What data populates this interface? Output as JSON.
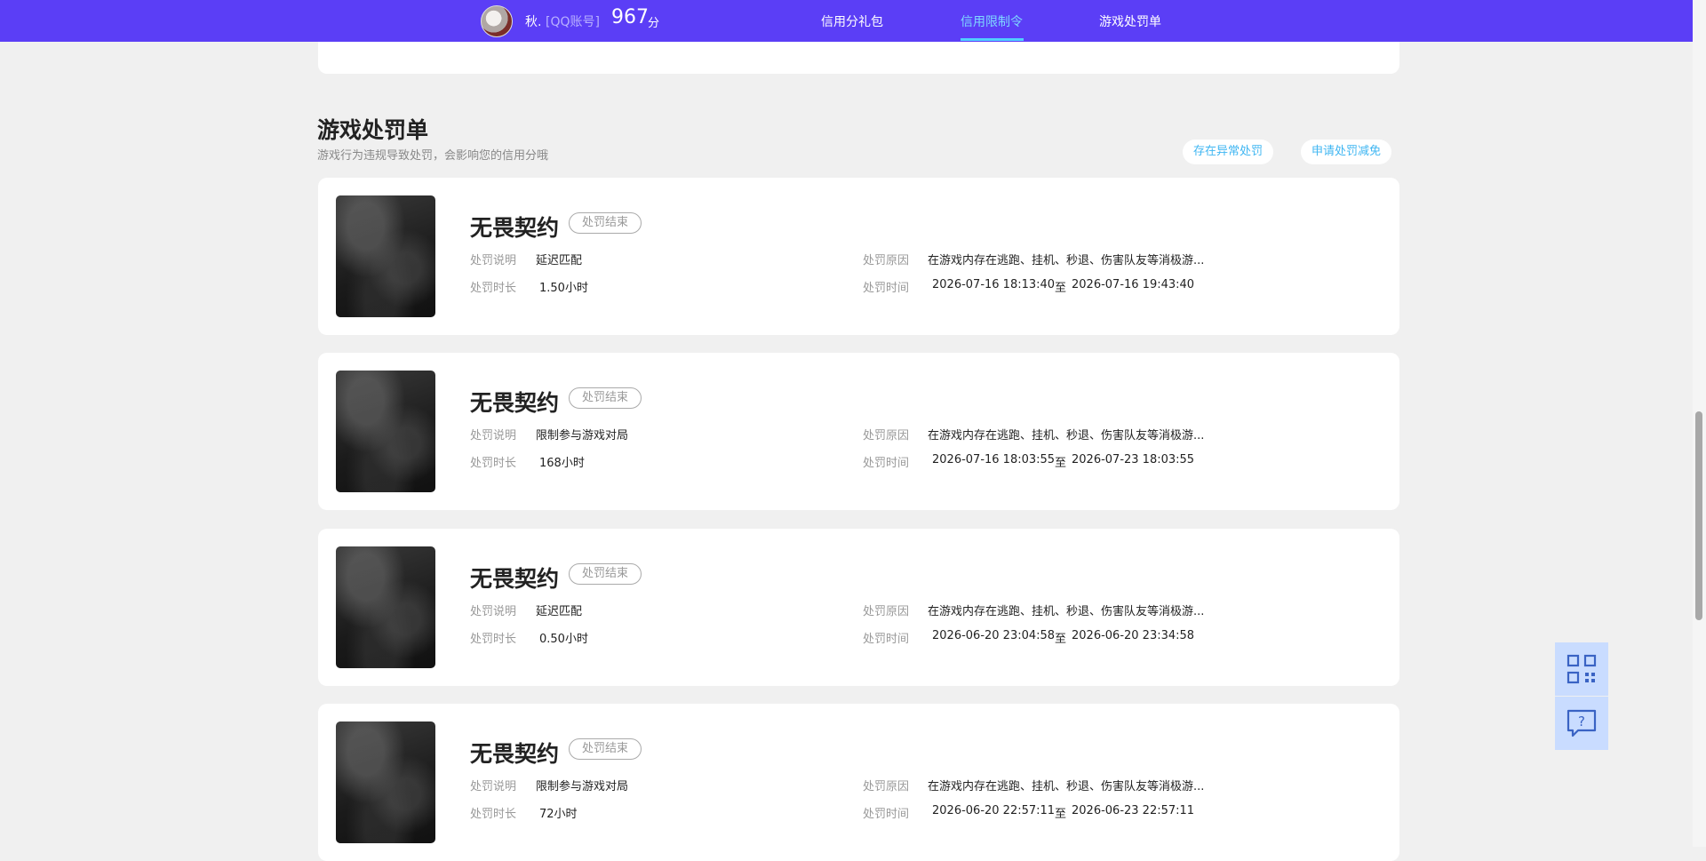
{
  "user": {
    "name": "秋.",
    "account_type": "[QQ账号]",
    "score": "967",
    "score_unit": "分"
  },
  "nav": {
    "tabs": [
      {
        "label": "信用分礼包",
        "active": false
      },
      {
        "label": "信用限制令",
        "active": true
      },
      {
        "label": "游戏处罚单",
        "active": false
      }
    ]
  },
  "section": {
    "title": "游戏处罚单",
    "subtitle": "游戏行为违规导致处罚，会影响您的信用分哦",
    "buttons": {
      "abnormal": "存在异常处罚",
      "reduce": "申请处罚减免"
    }
  },
  "labels": {
    "desc": "处罚说明",
    "duration": "处罚时长",
    "reason": "处罚原因",
    "time": "处罚时间",
    "to": "至"
  },
  "penalties": [
    {
      "game": "无畏契约",
      "status": "处罚结束",
      "desc": "延迟匹配",
      "duration": "1.50小时",
      "reason": "在游戏内存在逃跑、挂机、秒退、伤害队友等消极游...",
      "start": "2026-07-16 18:13:40",
      "end": "2026-07-16 19:43:40"
    },
    {
      "game": "无畏契约",
      "status": "处罚结束",
      "desc": "限制参与游戏对局",
      "duration": "168小时",
      "reason": "在游戏内存在逃跑、挂机、秒退、伤害队友等消极游...",
      "start": "2026-07-16 18:03:55",
      "end": "2026-07-23 18:03:55"
    },
    {
      "game": "无畏契约",
      "status": "处罚结束",
      "desc": "延迟匹配",
      "duration": "0.50小时",
      "reason": "在游戏内存在逃跑、挂机、秒退、伤害队友等消极游...",
      "start": "2026-06-20 23:04:58",
      "end": "2026-06-20 23:34:58"
    },
    {
      "game": "无畏契约",
      "status": "处罚结束",
      "desc": "限制参与游戏对局",
      "duration": "72小时",
      "reason": "在游戏内存在逃跑、挂机、秒退、伤害队友等消极游...",
      "start": "2026-06-20 22:57:11",
      "end": "2026-06-23 22:57:11"
    }
  ],
  "tools": {
    "qr_icon": "qr-code-icon",
    "help_icon": "help-chat-icon"
  },
  "colors": {
    "nav_bg": "#5b3ef6",
    "nav_active": "#7fd8ff",
    "accent_link": "#3fb6f2",
    "tool_bg": "#c9dcff"
  }
}
